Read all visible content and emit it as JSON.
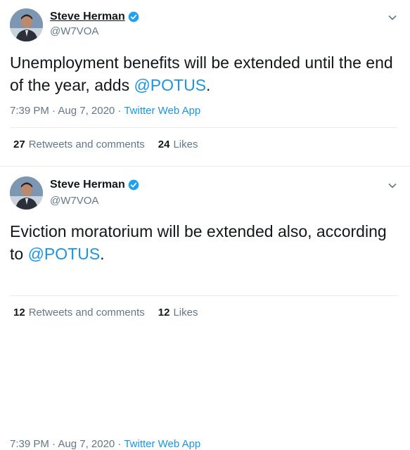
{
  "tweets": [
    {
      "display_name": "Steve Herman",
      "handle": "@W7VOA",
      "text_before": "Unemployment benefits will be extended until the end of the year, adds ",
      "mention": "@POTUS",
      "text_after": ".",
      "time": "7:39 PM · Aug 7, 2020 · ",
      "app": "Twitter Web App",
      "retweets_count": "27",
      "retweets_label": "Retweets and comments",
      "likes_count": "24",
      "likes_label": "Likes"
    },
    {
      "display_name": "Steve Herman",
      "handle": "@W7VOA",
      "text_before": "Eviction moratorium will be extended also, according to ",
      "mention": "@POTUS",
      "text_after": ".",
      "time": "7:39 PM · Aug 7, 2020 · ",
      "app": "Twitter Web App",
      "retweets_count": "12",
      "retweets_label": "Retweets and comments",
      "likes_count": "12",
      "likes_label": "Likes"
    }
  ],
  "colors": {
    "link": "#1b95e0",
    "secondary": "#657786",
    "verified": "#1da1f2"
  },
  "icons": {
    "verified": "verified-badge-icon",
    "menu": "chevron-down-icon"
  }
}
